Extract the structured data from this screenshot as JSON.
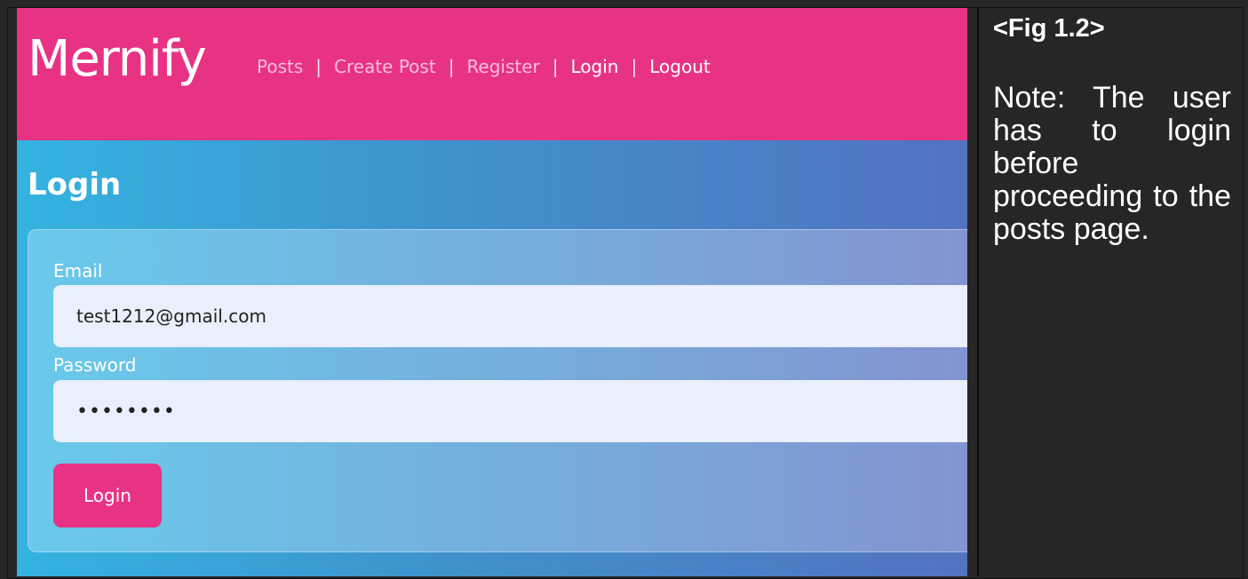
{
  "app": {
    "brand": "Mernify",
    "nav": [
      {
        "label": "Posts",
        "active": false
      },
      {
        "label": "Create Post",
        "active": false
      },
      {
        "label": "Register",
        "active": false
      },
      {
        "label": "Login",
        "active": true
      },
      {
        "label": "Logout",
        "active": true
      }
    ],
    "nav_separator": "|",
    "page_title": "Login",
    "form": {
      "email_label": "Email",
      "email_value": "test1212@gmail.com",
      "password_label": "Password",
      "password_value": "••••••••",
      "submit_label": "Login"
    },
    "colors": {
      "navbar": "#e83385",
      "button": "#e83385",
      "gradient_start": "#34b3e0",
      "gradient_end": "#5373c0"
    }
  },
  "note": {
    "fig": "<Fig 1.2>",
    "text": "Note: The user has to login before proceeding to the posts page."
  }
}
